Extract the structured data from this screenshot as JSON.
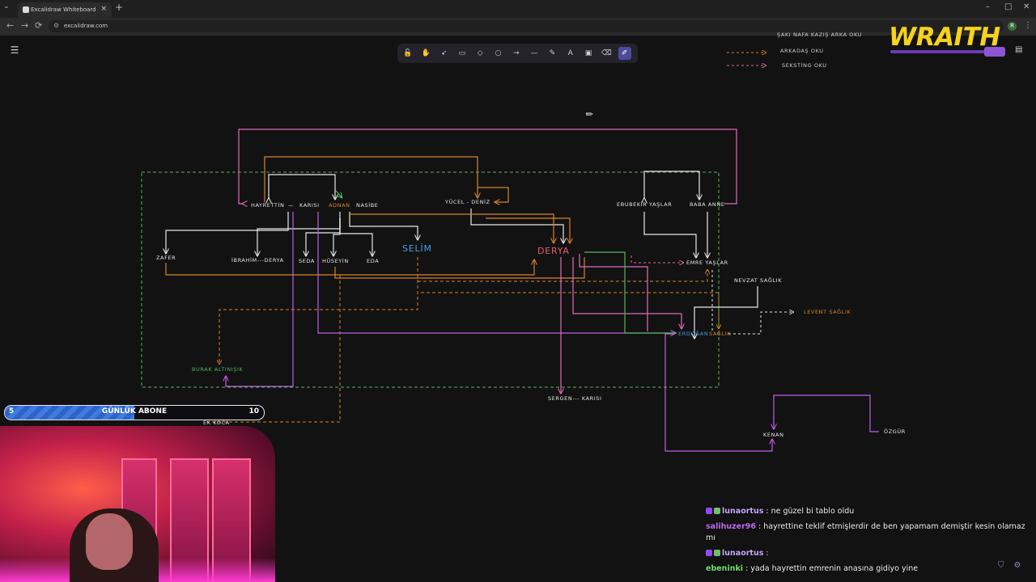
{
  "browser": {
    "tab_title": "Excalidraw Whiteboard",
    "tab_close": "×",
    "new_tab": "+",
    "url": "excalidraw.com",
    "nav": {
      "back": "←",
      "forward": "→",
      "reload": "⟳"
    },
    "window": {
      "minimize": "–",
      "maximize": "□",
      "close": "✕"
    },
    "profile_initial": "R"
  },
  "excalidraw": {
    "menu_icon": "☰",
    "tools": [
      {
        "name": "lock-icon",
        "glyph": "🔓"
      },
      {
        "name": "hand-icon",
        "glyph": "✋"
      },
      {
        "name": "select-icon",
        "glyph": "➶"
      },
      {
        "name": "rectangle-icon",
        "glyph": "▭"
      },
      {
        "name": "diamond-icon",
        "glyph": "◇"
      },
      {
        "name": "ellipse-icon",
        "glyph": "○"
      },
      {
        "name": "arrow-icon",
        "glyph": "→"
      },
      {
        "name": "line-icon",
        "glyph": "—"
      },
      {
        "name": "draw-icon",
        "glyph": "✎"
      },
      {
        "name": "text-icon",
        "glyph": "A"
      },
      {
        "name": "image-icon",
        "glyph": "▣"
      },
      {
        "name": "eraser-icon",
        "glyph": "⌫"
      },
      {
        "name": "laser-icon",
        "glyph": "✐"
      }
    ],
    "active_tool": "laser-icon",
    "library_icon": "▤"
  },
  "legend": {
    "top_label": "ŞAKI NAFA KAZIŞ ARKA OKU",
    "friend_arrow": "ARKADAŞ OKU",
    "sexting_arrow": "SEKSTİNG OKU",
    "friend_color": "#d9822b",
    "sexting_color": "#e06c8f"
  },
  "diagram_labels": {
    "hayrettin": "HAYRETTİN",
    "karisi": "KARISI",
    "adnan": "ADNAN",
    "nasibe": "NASİBE",
    "yucel": "YÜCEL  -  DENİZ",
    "ebubekir": "EBUBEKİR YAŞLAR",
    "baba_anne": "BABA  ANNE",
    "zafer": "ZAFER",
    "ibrahim": "İBRAHİM---DERYA",
    "seda": "SEDA",
    "huseyin": "HÜSEYİN",
    "eda": "EDA",
    "selim": "SELİM",
    "derya": "DERYA",
    "emre": "EMRE YAŞLAR",
    "nevzat": "NEVZAT SAĞLIK",
    "levent": "LEVENT SAĞLIK",
    "erdogan": "ERDOĞAN",
    "saglik": "SAĞLIK",
    "burak": "BURAK ALTINIŞIK",
    "sergen": "SERGEN--- KARISI",
    "ek_koca": "EK KOCA",
    "kenan": "KENAN",
    "ozgur": "ÖZGÜR",
    "dash": "—"
  },
  "overlay": {
    "brand": "WRAITH",
    "subs_goal": {
      "label": "GÜNLÜK ABONE",
      "current": "5",
      "target": "10",
      "progress": 0.5
    },
    "chat": [
      {
        "user": "lunaortus",
        "color": "#c9a9ff",
        "text": ": ne güzel bi tablo oldu",
        "badges": true
      },
      {
        "user": "salihuzer96",
        "color": "#c46cf0",
        "text": ": hayrettine teklif etmişlerdir de ben yapamam demiştir kesin olamaz mı",
        "badges": false
      },
      {
        "user": "lunaortus",
        "color": "#c9a9ff",
        "text": ": ",
        "badges": true
      },
      {
        "user": "ebeninki",
        "color": "#6ee36e",
        "text": ": yada hayrettin emrenin anasına gidiyo yine",
        "badges": false
      }
    ]
  }
}
